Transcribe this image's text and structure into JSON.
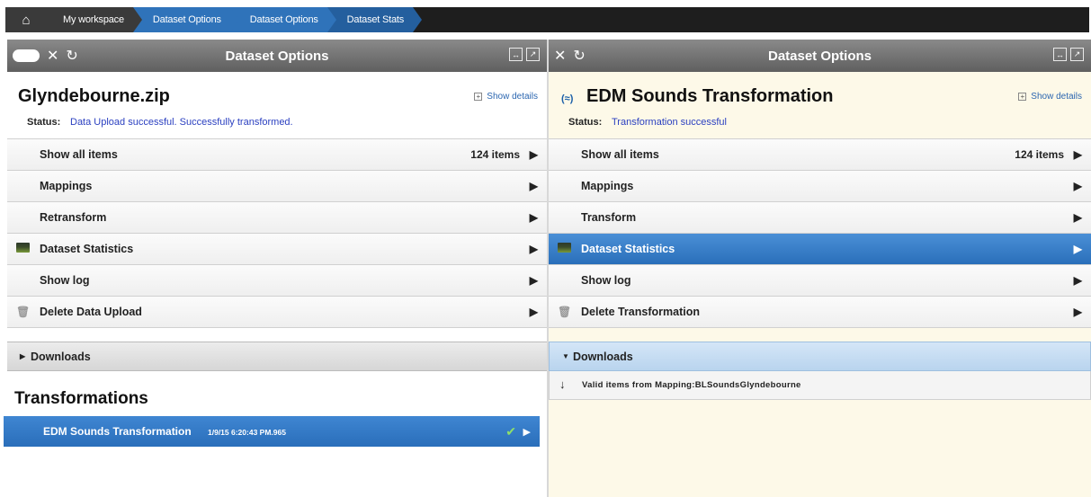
{
  "breadcrumb": {
    "home_icon": "home-icon",
    "items": [
      "My workspace",
      "Dataset Options",
      "Dataset Options",
      "Dataset Stats"
    ]
  },
  "left_panel": {
    "header_title": "Dataset Options",
    "dataset_title": "Glyndebourne.zip",
    "show_details": "Show details",
    "status_label": "Status:",
    "status_value": "Data Upload successful. Successfully transformed.",
    "menu": [
      {
        "label": "Show all items",
        "count": "124 items",
        "icon": ""
      },
      {
        "label": "Mappings",
        "count": "",
        "icon": ""
      },
      {
        "label": "Retransform",
        "count": "",
        "icon": ""
      },
      {
        "label": "Dataset Statistics",
        "count": "",
        "icon": "dataset-statistics-icon"
      },
      {
        "label": "Show log",
        "count": "",
        "icon": ""
      },
      {
        "label": "Delete Data Upload",
        "count": "",
        "icon": "trash-icon"
      }
    ],
    "downloads_label": "Downloads",
    "transformations_heading": "Transformations",
    "transformations": [
      {
        "name": "EDM Sounds Transformation",
        "date": "1/9/15 6:20:43 PM.965"
      }
    ]
  },
  "right_panel": {
    "header_title": "Dataset Options",
    "dataset_title": "EDM Sounds Transformation",
    "show_details": "Show details",
    "status_label": "Status:",
    "status_value": "Transformation successful",
    "menu": [
      {
        "label": "Show all items",
        "count": "124 items",
        "icon": ""
      },
      {
        "label": "Mappings",
        "count": "",
        "icon": ""
      },
      {
        "label": "Transform",
        "count": "",
        "icon": ""
      },
      {
        "label": "Dataset Statistics",
        "count": "",
        "icon": "dataset-statistics-icon",
        "active": true
      },
      {
        "label": "Show log",
        "count": "",
        "icon": ""
      },
      {
        "label": "Delete Transformation",
        "count": "",
        "icon": "trash-icon"
      }
    ],
    "downloads_label": "Downloads",
    "downloads": [
      {
        "label": "Valid items from Mapping:BLSoundsGlyndebourne"
      }
    ]
  },
  "colors": {
    "accent_blue": "#2f73ba",
    "status_text": "#2a3fc0",
    "right_panel_bg": "#fdf9e8"
  }
}
